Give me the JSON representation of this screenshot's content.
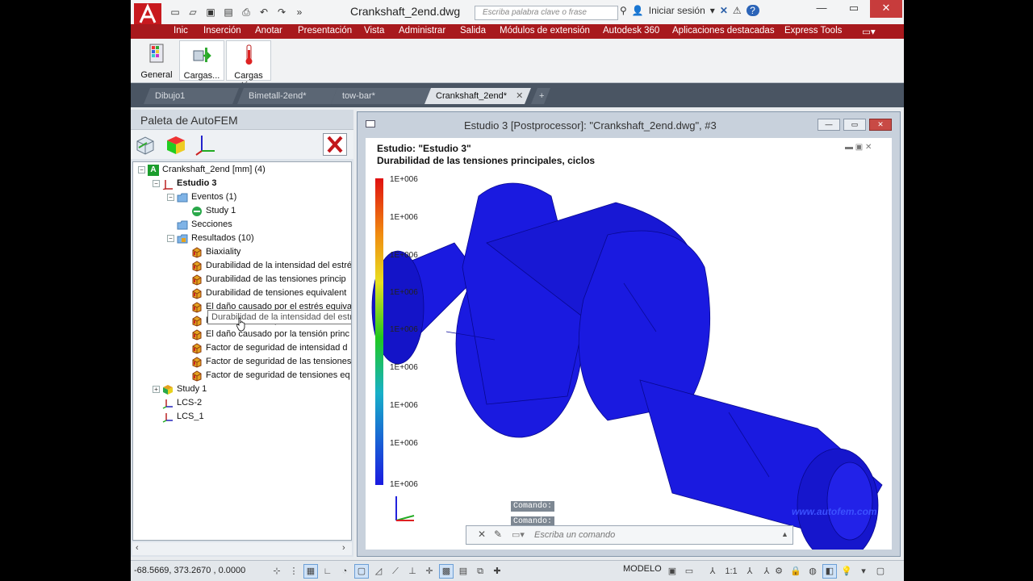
{
  "window": {
    "title": "Crankshaft_2end.dwg"
  },
  "search": {
    "placeholder": "Escriba palabra clave o frase"
  },
  "signin": "Iniciar sesión",
  "menu": [
    "Inic",
    "Inserción",
    "Anotar",
    "Presentación",
    "Vista",
    "Administrar",
    "Salida",
    "Módulos de extensión",
    "Autodesk 360",
    "Aplicaciones destacadas",
    "Express Tools"
  ],
  "ribbon": [
    {
      "label": "General",
      "icon": "grid-settings-icon"
    },
    {
      "label": "Cargas...",
      "icon": "load-arrow-icon"
    },
    {
      "label": "Cargas té...",
      "icon": "thermometer-icon"
    }
  ],
  "file_tabs": [
    {
      "label": "Dibujo1",
      "active": false
    },
    {
      "label": "Bimetall-2end*",
      "active": false
    },
    {
      "label": "tow-bar*",
      "active": false
    },
    {
      "label": "Crankshaft_2end*",
      "active": true
    }
  ],
  "palette": {
    "title": "Paleta de AutoFEM",
    "tree": [
      {
        "label": "Crankshaft_2end [mm]  (4)",
        "indent": 0,
        "exp": "−",
        "icon": "autofem-icon"
      },
      {
        "label": "Estudio 3",
        "indent": 1,
        "exp": "−",
        "icon": "study-icon",
        "bold": true
      },
      {
        "label": "Eventos (1)",
        "indent": 2,
        "exp": "−",
        "icon": "folder-icon"
      },
      {
        "label": "Study 1",
        "indent": 3,
        "icon": "event-icon"
      },
      {
        "label": "Secciones",
        "indent": 2,
        "icon": "folder-icon"
      },
      {
        "label": "Resultados (10)",
        "indent": 2,
        "exp": "−",
        "icon": "results-folder-icon"
      },
      {
        "label": "Biaxiality",
        "indent": 3,
        "icon": "result-icon"
      },
      {
        "label": "Durabilidad de la intensidad del estrés",
        "indent": 3,
        "icon": "result-icon"
      },
      {
        "label": "Durabilidad de las tensiones princip",
        "indent": 3,
        "icon": "result-icon"
      },
      {
        "label": "Durabilidad de tensiones equivalent",
        "indent": 3,
        "icon": "result-icon"
      },
      {
        "label": "El daño causado por el estrés equiva",
        "indent": 3,
        "icon": "result-icon"
      },
      {
        "label": "El daño causado por la intensidad d",
        "indent": 3,
        "icon": "result-icon"
      },
      {
        "label": "El daño causado por la tensión princ",
        "indent": 3,
        "icon": "result-icon"
      },
      {
        "label": "Factor de seguridad de intensidad d",
        "indent": 3,
        "icon": "result-icon"
      },
      {
        "label": "Factor de seguridad de las tensiones",
        "indent": 3,
        "icon": "result-icon"
      },
      {
        "label": "Factor de seguridad de tensiones eq",
        "indent": 3,
        "icon": "result-icon"
      },
      {
        "label": "Study 1",
        "indent": 1,
        "exp": "+",
        "icon": "study-cube-icon"
      },
      {
        "label": "LCS-2",
        "indent": 1,
        "icon": "axis-icon"
      },
      {
        "label": "LCS_1",
        "indent": 1,
        "icon": "axis-icon"
      }
    ],
    "tooltip": "Durabilidad de la intensidad del estrés"
  },
  "study_window": {
    "title": "Estudio 3 [Postprocessor]: \"Crankshaft_2end.dwg\", #3",
    "study_label": "Estudio: \"Estudio 3\"",
    "result_label": "Durabilidad de las tensiones principales, ciclos",
    "legend": [
      "1E+006",
      "1E+006",
      "1E+006",
      "1E+006",
      "1E+006",
      "1E+006",
      "1E+006",
      "1E+006",
      "1E+006"
    ],
    "command_history": [
      "Comando:",
      "Comando:"
    ],
    "command_placeholder": "Escriba un comando"
  },
  "status": {
    "coords": "-68.5669, 373.2670 , 0.0000",
    "model": "MODELO",
    "scale": "1:1"
  },
  "colors": {
    "menu_bg": "#a8191d",
    "part_blue": "#1a1ae0"
  }
}
